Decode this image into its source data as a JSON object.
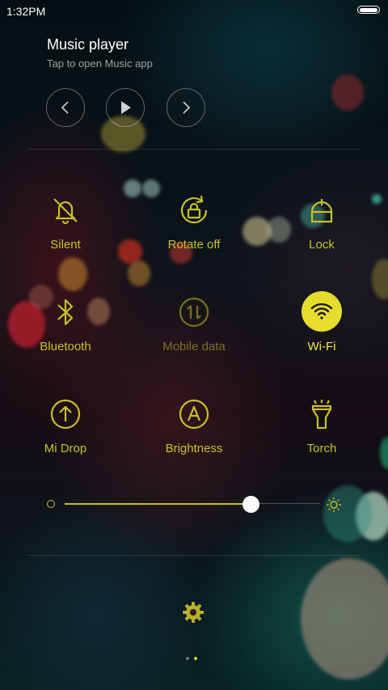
{
  "status": {
    "time": "1:32PM"
  },
  "music": {
    "title": "Music player",
    "subtitle": "Tap to open Music app",
    "controls": [
      "previous",
      "play",
      "next"
    ]
  },
  "toggles": [
    {
      "label": "Silent",
      "icon": "bell-off-icon",
      "state": "on"
    },
    {
      "label": "Rotate off",
      "icon": "rotate-lock-icon",
      "state": "on"
    },
    {
      "label": "Lock",
      "icon": "lock-icon",
      "state": "on"
    },
    {
      "label": "Bluetooth",
      "icon": "bluetooth-icon",
      "state": "on"
    },
    {
      "label": "Mobile data",
      "icon": "mobile-data-icon",
      "state": "off"
    },
    {
      "label": "Wi-Fi",
      "icon": "wifi-icon",
      "state": "active"
    },
    {
      "label": "Mi Drop",
      "icon": "mi-drop-icon",
      "state": "on"
    },
    {
      "label": "Brightness",
      "icon": "brightness-auto-icon",
      "state": "on"
    },
    {
      "label": "Torch",
      "icon": "torch-icon",
      "state": "on"
    }
  ],
  "brightness": {
    "level": 0.73
  },
  "pager": {
    "pages": 2,
    "current": 2
  },
  "colors": {
    "accent": "#c8c02a",
    "active_fill": "#e6dc2e",
    "active_icon": "#1a1a1a"
  }
}
